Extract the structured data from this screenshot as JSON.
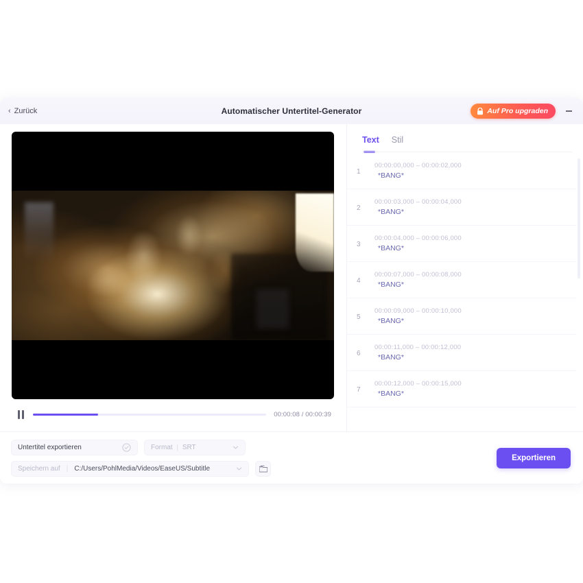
{
  "titlebar": {
    "back_label": "Zurück",
    "back_icon": "chevron-left-icon",
    "app_title": "Automatischer Untertitel-Generator",
    "upgrade_label": "Auf Pro upgraden",
    "upgrade_icon": "lock-icon",
    "minimize_icon": "minimize-icon"
  },
  "player": {
    "pause_icon": "pause-icon",
    "progress_percent": 28,
    "current_time": "00:00:08",
    "total_time": "00:00:39",
    "time_label": "00:00:08 / 00:00:39"
  },
  "subtitles": {
    "tabs": [
      {
        "label": "Text",
        "active": true
      },
      {
        "label": "Stil",
        "active": false
      }
    ],
    "rows": [
      {
        "index": "1",
        "time": "00:00:00,000 – 00:00:02,000",
        "text": "*BANG*"
      },
      {
        "index": "2",
        "time": "00:00:03,000 – 00:00:04,000",
        "text": "*BANG*"
      },
      {
        "index": "3",
        "time": "00:00:04,000 – 00:00:06,000",
        "text": "*BANG*"
      },
      {
        "index": "4",
        "time": "00:00:07,000 – 00:00:08,000",
        "text": "*BANG*"
      },
      {
        "index": "5",
        "time": "00:00:09,000 – 00:00:10,000",
        "text": "*BANG*"
      },
      {
        "index": "6",
        "time": "00:00:11,000 – 00:00:12,000",
        "text": "*BANG*"
      },
      {
        "index": "7",
        "time": "00:00:12,000 – 00:00:15,000",
        "text": "*BANG*"
      }
    ]
  },
  "footer": {
    "export_subtitle_label": "Untertitel exportieren",
    "export_check_icon": "check-circle-icon",
    "format_label": "Format",
    "format_value": "SRT",
    "format_chevron_icon": "chevron-down-icon",
    "save_to_label": "Speichern auf",
    "save_path": "C:/Users/PohlMedia/Videos/EaseUS/Subtitle",
    "path_chevron_icon": "chevron-down-icon",
    "folder_icon": "folder-icon",
    "export_button_label": "Exportieren"
  },
  "colors": {
    "accent_purple": "#6c4ff0",
    "upgrade_gradient_start": "#ff8a3d",
    "upgrade_gradient_end": "#fb4a62",
    "muted_text": "#b9b8cb"
  }
}
